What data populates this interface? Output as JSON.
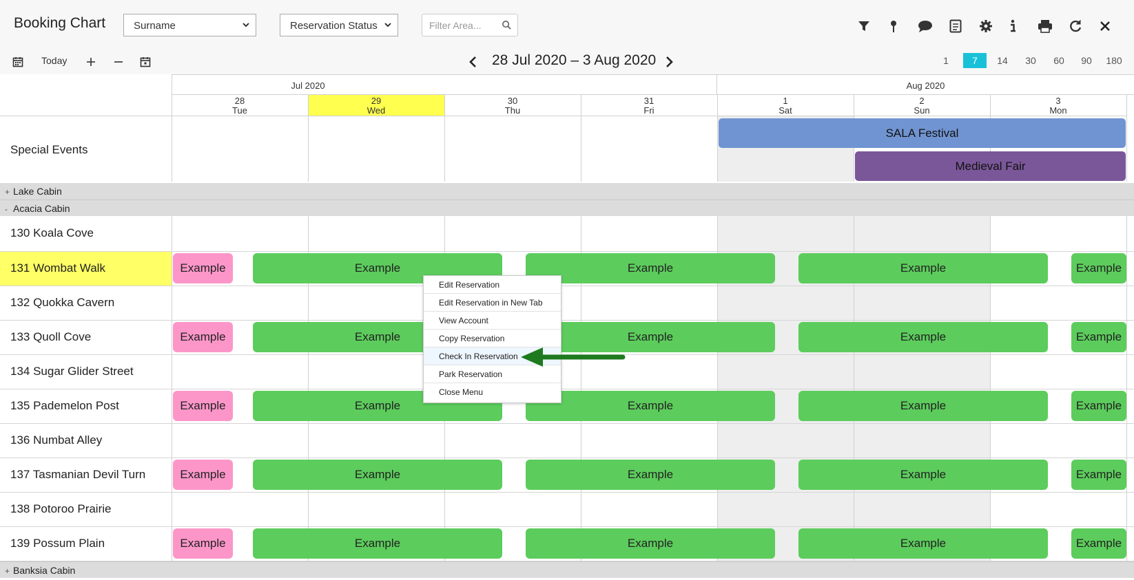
{
  "header": {
    "title": "Booking Chart",
    "sort_select": "Surname",
    "status_select": "Reservation Status",
    "filter_placeholder": "Filter Area..."
  },
  "icons": {
    "filter": "filter-icon",
    "map_pin": "map-pin-icon",
    "comment": "comment-icon",
    "notes": "notes-icon",
    "settings": "gear-icon",
    "info": "info-icon",
    "print": "print-icon",
    "refresh": "refresh-icon",
    "close": "close-icon"
  },
  "nav": {
    "today_label": "Today",
    "date_range": "28 Jul 2020 – 3 Aug 2020",
    "zoom_levels": [
      "1",
      "7",
      "14",
      "30",
      "60",
      "90",
      "180"
    ],
    "active_zoom": "7"
  },
  "calendar": {
    "months": [
      "Jul 2020",
      "Aug 2020"
    ],
    "days": [
      {
        "num": "28",
        "dow": "Tue"
      },
      {
        "num": "29",
        "dow": "Wed"
      },
      {
        "num": "30",
        "dow": "Thu"
      },
      {
        "num": "31",
        "dow": "Fri"
      },
      {
        "num": "1",
        "dow": "Sat"
      },
      {
        "num": "2",
        "dow": "Sun"
      },
      {
        "num": "3",
        "dow": "Mon"
      }
    ],
    "today_index": 1
  },
  "special_events": {
    "label": "Special Events",
    "events": [
      "SALA Festival",
      "Medieval Fair"
    ]
  },
  "groups": {
    "lake": {
      "toggle": "+",
      "name": "Lake Cabin"
    },
    "acacia": {
      "toggle": "-",
      "name": "Acacia Cabin"
    },
    "banksia": {
      "toggle": "+",
      "name": "Banksia Cabin"
    }
  },
  "rooms": [
    "130 Koala Cove",
    "131 Wombat Walk",
    "132 Quokka Cavern",
    "133 Quoll Cove",
    "134 Sugar Glider Street",
    "135 Pademelon Post",
    "136 Numbat Alley",
    "137 Tasmanian Devil Turn",
    "138 Potoroo Prairie",
    "139 Possum Plain"
  ],
  "reservation_label": "Example",
  "context_menu": {
    "items": [
      "Edit Reservation",
      "Edit Reservation in New Tab",
      "View Account",
      "Copy Reservation",
      "Check In Reservation",
      "Park Reservation",
      "Close Menu"
    ],
    "highlighted": "Check In Reservation"
  },
  "colors": {
    "today": "#ffff50",
    "zoom_active": "#19c1d8",
    "reservation_green": "#5ccc5c",
    "reservation_pink": "#fc96c9",
    "sala_event": "#7094d1",
    "medieval_event": "#7a5799",
    "annotation_arrow": "#1e7a1e"
  }
}
